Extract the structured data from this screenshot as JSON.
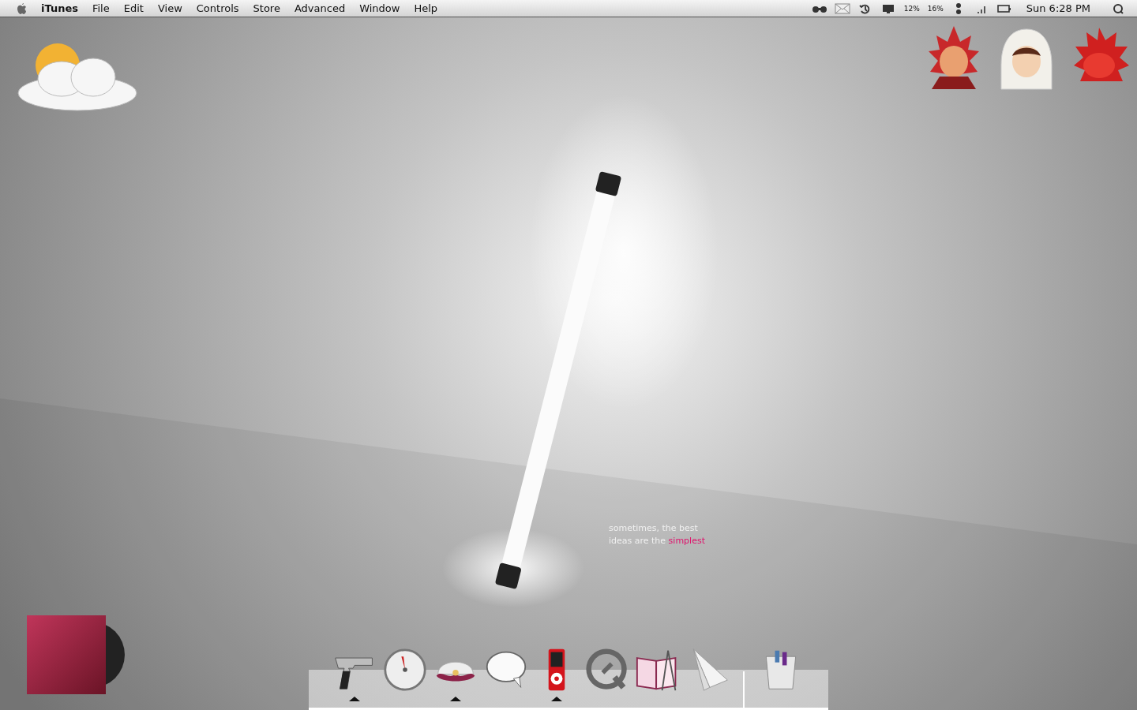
{
  "menu_bar": {
    "app_name": "iTunes",
    "menus": [
      "File",
      "Edit",
      "View",
      "Controls",
      "Store",
      "Advanced",
      "Window",
      "Help"
    ],
    "status_items": [
      {
        "kind": "binoculars"
      },
      {
        "kind": "mail"
      },
      {
        "kind": "time-machine"
      },
      {
        "kind": "display"
      },
      {
        "kind": "text",
        "label": "12%"
      },
      {
        "kind": "text",
        "label": "16%"
      },
      {
        "kind": "dots"
      },
      {
        "kind": "signal"
      },
      {
        "kind": "battery"
      }
    ],
    "clock": "Sun 6:28 PM"
  },
  "desktop": {
    "tagline": {
      "text": "sometimes, the best ideas are the",
      "highlight": "simplest"
    },
    "avatars": [
      {
        "kind": "red-spiky"
      },
      {
        "kind": "hooded"
      },
      {
        "kind": "red-dragon"
      }
    ]
  },
  "dock": {
    "items": [
      {
        "kind": "pistol",
        "running": true
      },
      {
        "kind": "dashboard",
        "running": false
      },
      {
        "kind": "clam",
        "running": true
      },
      {
        "kind": "speech",
        "running": false
      },
      {
        "kind": "ipod",
        "running": true
      },
      {
        "kind": "quicktime",
        "running": false
      },
      {
        "kind": "book",
        "running": false
      },
      {
        "kind": "plane",
        "running": false
      },
      {
        "kind": "trash",
        "running": false
      }
    ]
  }
}
